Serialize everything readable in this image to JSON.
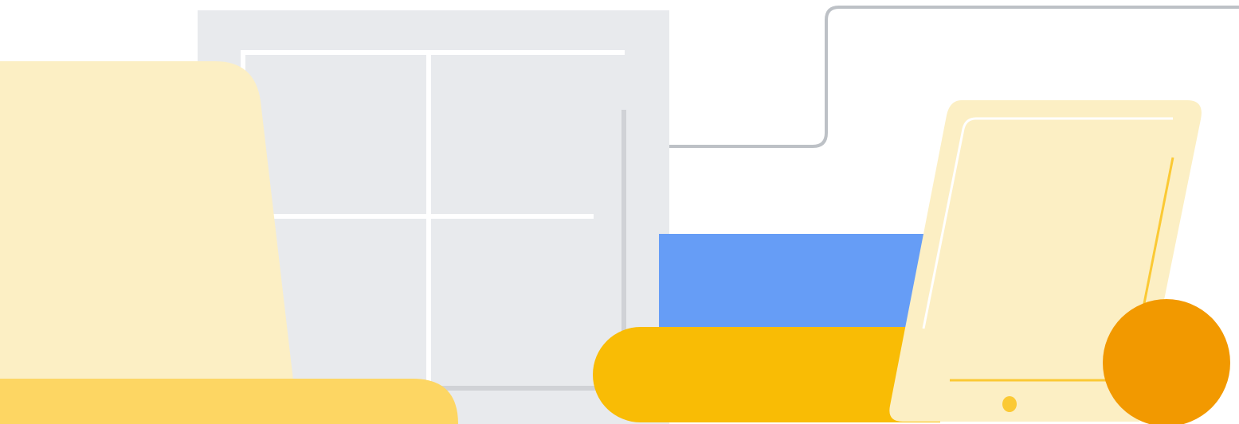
{
  "illustration": {
    "palette": {
      "background": "#ffffff",
      "window_panel": "#e8eaed",
      "window_frame_lines": "#ffffff",
      "window_shadow_lines": "#d0d2d6",
      "connector_line": "#bdc1c6",
      "pale_yellow": "#fcefc4",
      "mid_yellow": "#fdd663",
      "deep_yellow": "#f9bc05",
      "tablet_accent": "#fbc934",
      "blue": "#669df6",
      "orange": "#f29900"
    },
    "shapes": [
      "window-panel",
      "connector-line",
      "laptop-screen",
      "laptop-base",
      "blue-block",
      "yellow-pill",
      "tablet",
      "orange-circle"
    ]
  }
}
